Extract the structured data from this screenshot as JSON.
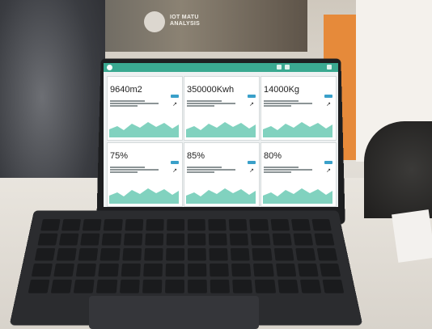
{
  "banner": {
    "line1": "IOT MATU",
    "line2": "ANALYSIS"
  },
  "app": {
    "title": "",
    "accent": "#3aa991"
  },
  "tiles": [
    {
      "value": "9640m2",
      "chart_color": "#57c3a9"
    },
    {
      "value": "350000Kwh",
      "chart_color": "#57c3a9"
    },
    {
      "value": "14000Kg",
      "chart_color": "#57c3a9"
    },
    {
      "value": "75%",
      "chart_color": "#57c3a9"
    },
    {
      "value": "85%",
      "chart_color": "#57c3a9"
    },
    {
      "value": "80%",
      "chart_color": "#57c3a9"
    }
  ],
  "icons": [
    "app-logo-icon",
    "header-icon",
    "trend-icon"
  ],
  "colors": {
    "keyboard": "#2b2c2f",
    "bezel": "#1d1e20",
    "accent": "#3aa991"
  }
}
